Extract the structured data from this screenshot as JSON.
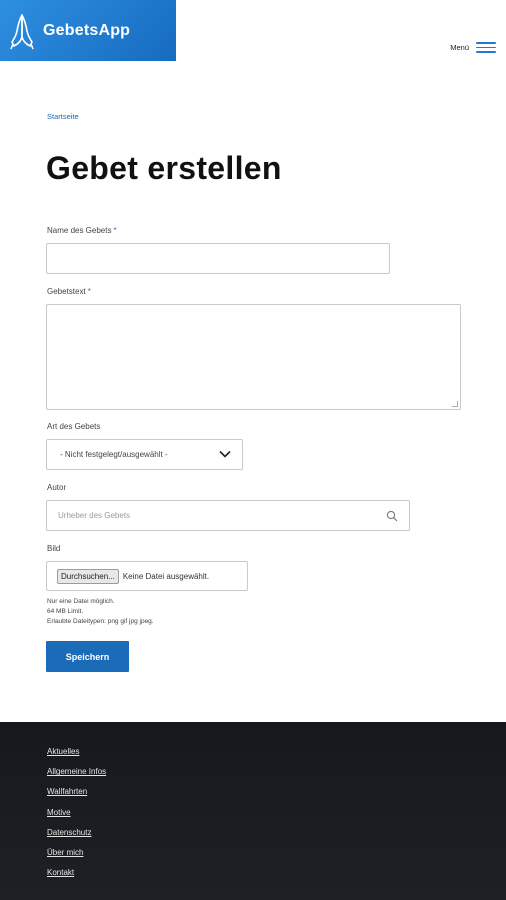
{
  "header": {
    "app_name": "GebetsApp",
    "menu_label": "Menü",
    "logo_icon": "praying-hands-icon",
    "brand_color": "#1f7ad1"
  },
  "breadcrumb": {
    "home": "Startseite"
  },
  "page": {
    "title": "Gebet erstellen"
  },
  "form": {
    "name": {
      "label": "Name des Gebets",
      "required_mark": "*",
      "value": ""
    },
    "text": {
      "label": "Gebetstext",
      "required_mark": "*",
      "value": ""
    },
    "type": {
      "label": "Art des Gebets",
      "selected": "- Nicht festgelegt/ausgewählt -"
    },
    "author": {
      "label": "Autor",
      "placeholder": "Urheber des Gebets"
    },
    "image": {
      "label": "Bild",
      "browse_label": "Durchsuchen...",
      "file_status": "Keine Datei ausgewählt.",
      "help_lines": [
        "Nur eine Datei möglich.",
        "64 MB Limit.",
        "Erlaubte Dateitypen: png gif jpg jpeg."
      ]
    },
    "submit_label": "Speichern"
  },
  "footer": {
    "links": [
      "Aktuelles",
      "Allgemeine Infos",
      "Wallfahrten",
      "Motive",
      "Datenschutz",
      "Über mich",
      "Kontakt"
    ]
  }
}
